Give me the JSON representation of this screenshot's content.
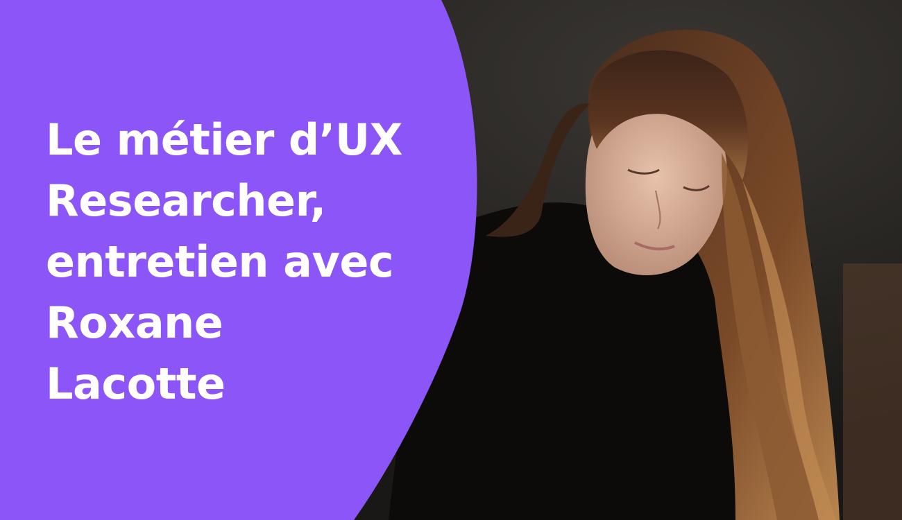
{
  "colors": {
    "accent": "#8b55f7",
    "title_text": "#ffffff",
    "photo_background": "#1c1a18"
  },
  "title": {
    "lines": [
      "Le métier d’UX",
      "Researcher,",
      "entretien avec",
      "Roxane",
      "Lacotte"
    ]
  },
  "image": {
    "subject": "portrait-photo"
  }
}
